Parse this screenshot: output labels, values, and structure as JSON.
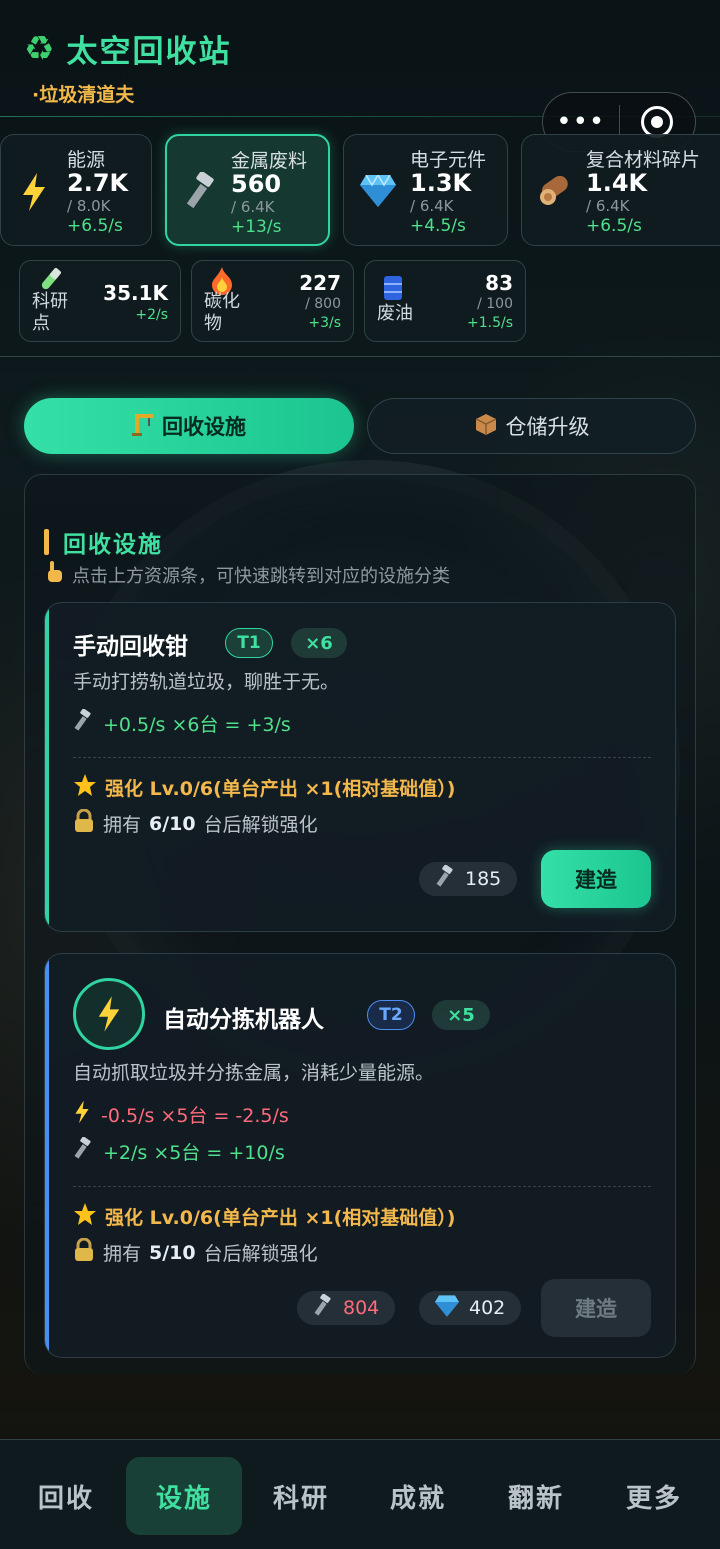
{
  "app": {
    "title": "太空回收站",
    "subtitle": "·垃圾清道夫"
  },
  "capsule": {
    "more": "•••"
  },
  "resources": [
    {
      "name": "能源",
      "value": "2.7K",
      "cap": "/ 8.0K",
      "rate": "+6.5/s",
      "icon": "lightning-icon"
    },
    {
      "name": "金属废料",
      "value": "560",
      "cap": "/ 6.4K",
      "rate": "+13/s",
      "icon": "bolt-screw-icon",
      "selected": true
    },
    {
      "name": "电子元件",
      "value": "1.3K",
      "cap": "/ 6.4K",
      "rate": "+4.5/s",
      "icon": "gem-icon"
    },
    {
      "name": "复合材料碎片",
      "value": "1.4K",
      "cap": "/ 6.4K",
      "rate": "+6.5/s",
      "icon": "wood-log-icon"
    }
  ],
  "secondary_resources": [
    {
      "name": "科研点",
      "value": "35.1K",
      "cap": "",
      "rate": "+2/s",
      "icon": "test-tube-icon"
    },
    {
      "name": "碳化物",
      "value": "227",
      "cap": "/ 800",
      "rate": "+3/s",
      "icon": "fire-icon"
    },
    {
      "name": "废油",
      "value": "83",
      "cap": "/ 100",
      "rate": "+1.5/s",
      "icon": "oil-barrel-icon"
    }
  ],
  "tabs": [
    {
      "label": "回收设施",
      "icon": "crane-icon",
      "active": true
    },
    {
      "label": "仓储升级",
      "icon": "box-icon",
      "active": false
    }
  ],
  "section": {
    "title": "回收设施",
    "hint": "点击上方资源条，可快速跳转到对应的设施分类"
  },
  "facilities": [
    {
      "name": "手动回收钳",
      "tier": "T1",
      "count": "×6",
      "desc": "手动打捞轨道垃圾，聊胜于无。",
      "outputs": [
        {
          "text": "+0.5/s ×6台 = +3/s",
          "kind": "gain"
        }
      ],
      "enhance": "强化 Lv.0/6(单台产出 ×1(相对基础值）)",
      "lock_prefix": "拥有",
      "lock_count": "6/10",
      "lock_suffix": "台后解锁强化",
      "costs": [
        {
          "amount": "185",
          "icon": "bolt-screw-icon",
          "insufficient": false
        }
      ],
      "build": "建造",
      "build_enabled": true
    },
    {
      "name": "自动分拣机器人",
      "tier": "T2",
      "count": "×5",
      "desc": "自动抓取垃圾并分拣金属，消耗少量能源。",
      "outputs": [
        {
          "text": "-0.5/s ×5台 = -2.5/s",
          "kind": "consume"
        },
        {
          "text": "+2/s ×5台 = +10/s",
          "kind": "gain"
        }
      ],
      "enhance": "强化 Lv.0/6(单台产出 ×1(相对基础值）)",
      "lock_prefix": "拥有",
      "lock_count": "5/10",
      "lock_suffix": "台后解锁强化",
      "costs": [
        {
          "amount": "804",
          "icon": "bolt-screw-icon",
          "insufficient": true
        },
        {
          "amount": "402",
          "icon": "gem-icon",
          "insufficient": false
        }
      ],
      "build": "建造",
      "build_enabled": false
    }
  ],
  "nav": [
    {
      "label": "回收",
      "active": false
    },
    {
      "label": "设施",
      "active": true
    },
    {
      "label": "科研",
      "active": false
    },
    {
      "label": "成就",
      "active": false
    },
    {
      "label": "翻新",
      "active": false
    },
    {
      "label": "更多",
      "active": false
    }
  ],
  "colors": {
    "accent": "#34e0a8",
    "gold": "#f2b84b",
    "gain": "#4ee08a",
    "loss": "#ff6b7a",
    "t2": "#4a8ef0"
  }
}
